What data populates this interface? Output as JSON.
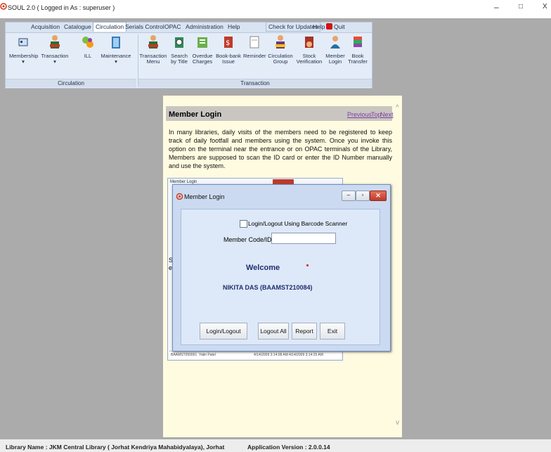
{
  "window": {
    "title": "SOUL 2.0 ( Logged in As : superuser )",
    "controls": [
      "–",
      "□",
      "X"
    ]
  },
  "menu": {
    "items": [
      "Acquisition",
      "Catalogue",
      "Circulation",
      "Serials Control",
      "OPAC",
      "Administration",
      "Help",
      "Check for Updates",
      "Help",
      "Quit"
    ],
    "active": "Circulation"
  },
  "ribbon": {
    "circulation_group": {
      "label": "Circulation",
      "buttons": [
        {
          "line1": "Membership",
          "line2": "▾"
        },
        {
          "line1": "Transaction",
          "line2": "▾"
        },
        {
          "line1": "ILL",
          "line2": ""
        },
        {
          "line1": "Maintenance",
          "line2": "▾"
        }
      ]
    },
    "transaction_group": {
      "label": "Transaction",
      "buttons": [
        {
          "line1": "Transaction",
          "line2": "Menu"
        },
        {
          "line1": "Search",
          "line2": "by Title"
        },
        {
          "line1": "Overdue",
          "line2": "Charges"
        },
        {
          "line1": "Book-bank",
          "line2": "Issue"
        },
        {
          "line1": "Reminder",
          "line2": ""
        },
        {
          "line1": "Circulation",
          "line2": "Group"
        },
        {
          "line1": "Stock",
          "line2": "Verification"
        },
        {
          "line1": "Member",
          "line2": "Login"
        },
        {
          "line1": "Book",
          "line2": "Transfer"
        }
      ]
    }
  },
  "doc": {
    "heading": "Member Login",
    "nav": [
      "Previous",
      "Top",
      "Next"
    ],
    "paragraph": "In many libraries, daily visits of the members need to be registered to keep track of daily footfall and members using the system. Once you invoke this option on the terminal near the entrance or on OPAC terminals of the Library, Members are supposed to scan the ID card or enter the ID Number manually and use the system.",
    "bg_window_title": "Member Login",
    "bg_fragment_1": "Sl",
    "bg_fragment_2": "el",
    "bg_row": [
      "BAAMST050001",
      "Yatin Patel",
      "4/14/2009 3:14:08 AM",
      "4/14/2009 3:14:25 AM"
    ]
  },
  "dialog": {
    "title": "Member Login",
    "checkbox_label": "Login/Logout Using Barcode Scanner",
    "checkbox_checked": false,
    "member_code_label": "Member Code/ID",
    "member_code_value": "",
    "welcome": "Welcome",
    "member_name": "NIKITA DAS (BAAMST210084)",
    "buttons": [
      "Login/Logout",
      "Logout All",
      "Report",
      "Exit"
    ]
  },
  "status": {
    "library": "Library Name : JKM Central Library ( Jorhat Kendriya Mahabidyalaya), Jorhat",
    "version": "Application Version : 2.0.0.14"
  },
  "colors": {
    "accent_red": "#d11414",
    "welcome_text": "#1f2f6e"
  }
}
